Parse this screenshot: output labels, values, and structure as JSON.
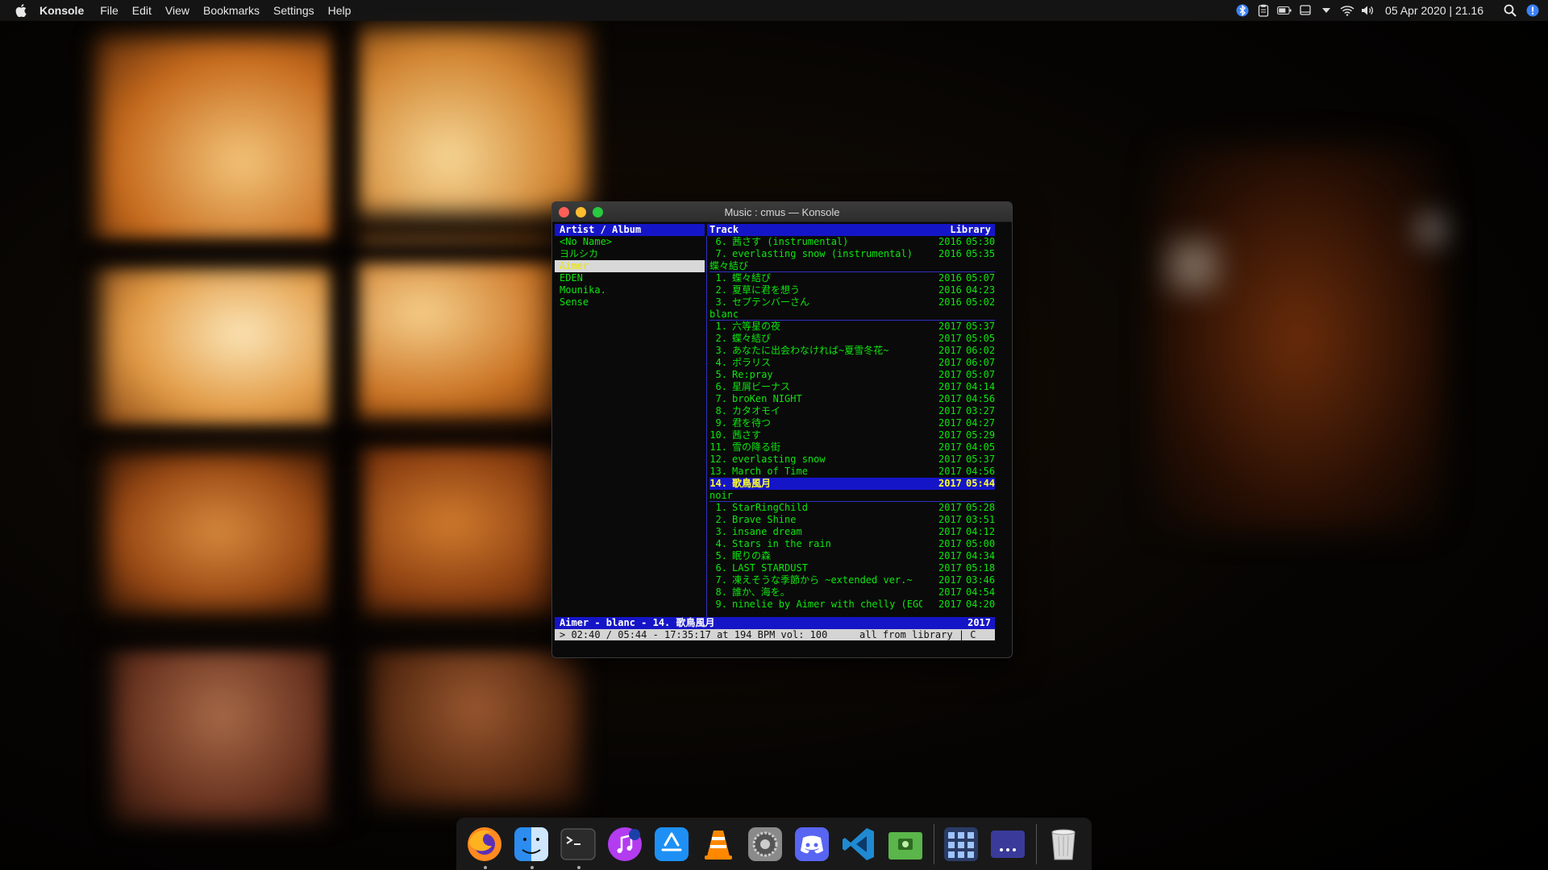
{
  "menubar": {
    "app_name": "Konsole",
    "menus": [
      "File",
      "Edit",
      "View",
      "Bookmarks",
      "Settings",
      "Help"
    ],
    "clock": "05 Apr 2020 | 21.16",
    "tray_icons": [
      "bluetooth-icon",
      "clipboard-icon",
      "battery-icon",
      "display-icon",
      "dropdown-arrow-icon",
      "wifi-icon",
      "volume-icon"
    ]
  },
  "window": {
    "title": "Music : cmus — Konsole"
  },
  "cmus": {
    "left_header": "Artist / Album",
    "track_header": "Track",
    "library_header": "Library",
    "artists": [
      {
        "label": "<No Name>",
        "selected": false
      },
      {
        "label": "ヨルシカ",
        "selected": false
      },
      {
        "label": "Aimer",
        "selected": true
      },
      {
        "label": "EDEN",
        "selected": false
      },
      {
        "label": "Mounika.",
        "selected": false
      },
      {
        "label": "Sense",
        "selected": false
      }
    ],
    "rows": [
      {
        "kind": "track",
        "num": "6.",
        "title": "茜さす (instrumental)",
        "year": "2016",
        "dur": "05:30"
      },
      {
        "kind": "track",
        "num": "7.",
        "title": "everlasting snow (instrumental)",
        "year": "2016",
        "dur": "05:35"
      },
      {
        "kind": "album",
        "name": "蝶々結び"
      },
      {
        "kind": "track",
        "num": "1.",
        "title": "蝶々結び",
        "year": "2016",
        "dur": "05:07"
      },
      {
        "kind": "track",
        "num": "2.",
        "title": "夏草に君を想う",
        "year": "2016",
        "dur": "04:23"
      },
      {
        "kind": "track",
        "num": "3.",
        "title": "セプテンバーさん",
        "year": "2016",
        "dur": "05:02"
      },
      {
        "kind": "album",
        "name": "blanc"
      },
      {
        "kind": "track",
        "num": "1.",
        "title": "六等星の夜",
        "year": "2017",
        "dur": "05:37"
      },
      {
        "kind": "track",
        "num": "2.",
        "title": "蝶々結び",
        "year": "2017",
        "dur": "05:05"
      },
      {
        "kind": "track",
        "num": "3.",
        "title": "あなたに出会わなければ~夏雪冬花~",
        "year": "2017",
        "dur": "06:02"
      },
      {
        "kind": "track",
        "num": "4.",
        "title": "ポラリス",
        "year": "2017",
        "dur": "06:07"
      },
      {
        "kind": "track",
        "num": "5.",
        "title": "Re:pray",
        "year": "2017",
        "dur": "05:07"
      },
      {
        "kind": "track",
        "num": "6.",
        "title": "星屑ビーナス",
        "year": "2017",
        "dur": "04:14"
      },
      {
        "kind": "track",
        "num": "7.",
        "title": "broKen NIGHT",
        "year": "2017",
        "dur": "04:56"
      },
      {
        "kind": "track",
        "num": "8.",
        "title": "カタオモイ",
        "year": "2017",
        "dur": "03:27"
      },
      {
        "kind": "track",
        "num": "9.",
        "title": "君を待つ",
        "year": "2017",
        "dur": "04:27"
      },
      {
        "kind": "track",
        "num": "10.",
        "title": "茜さす",
        "year": "2017",
        "dur": "05:29"
      },
      {
        "kind": "track",
        "num": "11.",
        "title": "雪の降る街",
        "year": "2017",
        "dur": "04:05"
      },
      {
        "kind": "track",
        "num": "12.",
        "title": "everlasting snow",
        "year": "2017",
        "dur": "05:37"
      },
      {
        "kind": "track",
        "num": "13.",
        "title": "March of Time",
        "year": "2017",
        "dur": "04:56"
      },
      {
        "kind": "track",
        "num": "14.",
        "title": "歌鳥風月",
        "year": "2017",
        "dur": "05:44",
        "playing": true
      },
      {
        "kind": "album",
        "name": "noir"
      },
      {
        "kind": "track",
        "num": "1.",
        "title": "StarRingChild",
        "year": "2017",
        "dur": "05:28"
      },
      {
        "kind": "track",
        "num": "2.",
        "title": "Brave Shine",
        "year": "2017",
        "dur": "03:51"
      },
      {
        "kind": "track",
        "num": "3.",
        "title": "insane dream",
        "year": "2017",
        "dur": "04:12"
      },
      {
        "kind": "track",
        "num": "4.",
        "title": "Stars in the rain",
        "year": "2017",
        "dur": "05:00"
      },
      {
        "kind": "track",
        "num": "5.",
        "title": "眠りの森",
        "year": "2017",
        "dur": "04:34"
      },
      {
        "kind": "track",
        "num": "6.",
        "title": "LAST STARDUST",
        "year": "2017",
        "dur": "05:18"
      },
      {
        "kind": "track",
        "num": "7.",
        "title": "凍えそうな季節から ~extended ver.~",
        "year": "2017",
        "dur": "03:46"
      },
      {
        "kind": "track",
        "num": "8.",
        "title": "誰か、海を。",
        "year": "2017",
        "dur": "04:54"
      },
      {
        "kind": "track",
        "num": "9.",
        "title": "ninelie by Aimer with chelly (EGOI",
        "year": "2017",
        "dur": "04:20"
      }
    ],
    "now_playing": "Aimer - blanc - 14. 歌鳥風月",
    "now_playing_year": "2017",
    "status_left": "> 02:40 / 05:44 - 17:35:17 at 194 BPM vol: 100",
    "status_right": "all from library | C"
  },
  "dock": {
    "apps": [
      {
        "name": "firefox-icon",
        "running": true
      },
      {
        "name": "finder-icon",
        "running": true
      },
      {
        "name": "terminal-icon",
        "running": true
      },
      {
        "name": "music-icon",
        "running": false
      },
      {
        "name": "app-store-icon",
        "running": false
      },
      {
        "name": "vlc-icon",
        "running": false
      },
      {
        "name": "system-settings-icon",
        "running": false
      },
      {
        "name": "discord-icon",
        "running": false
      },
      {
        "name": "vscode-icon",
        "running": false
      },
      {
        "name": "screenshot-icon",
        "running": false
      },
      {
        "name": "launchpad-icon",
        "running": false
      },
      {
        "name": "more-apps-icon",
        "running": false
      },
      {
        "name": "trash-icon",
        "running": false
      }
    ]
  }
}
